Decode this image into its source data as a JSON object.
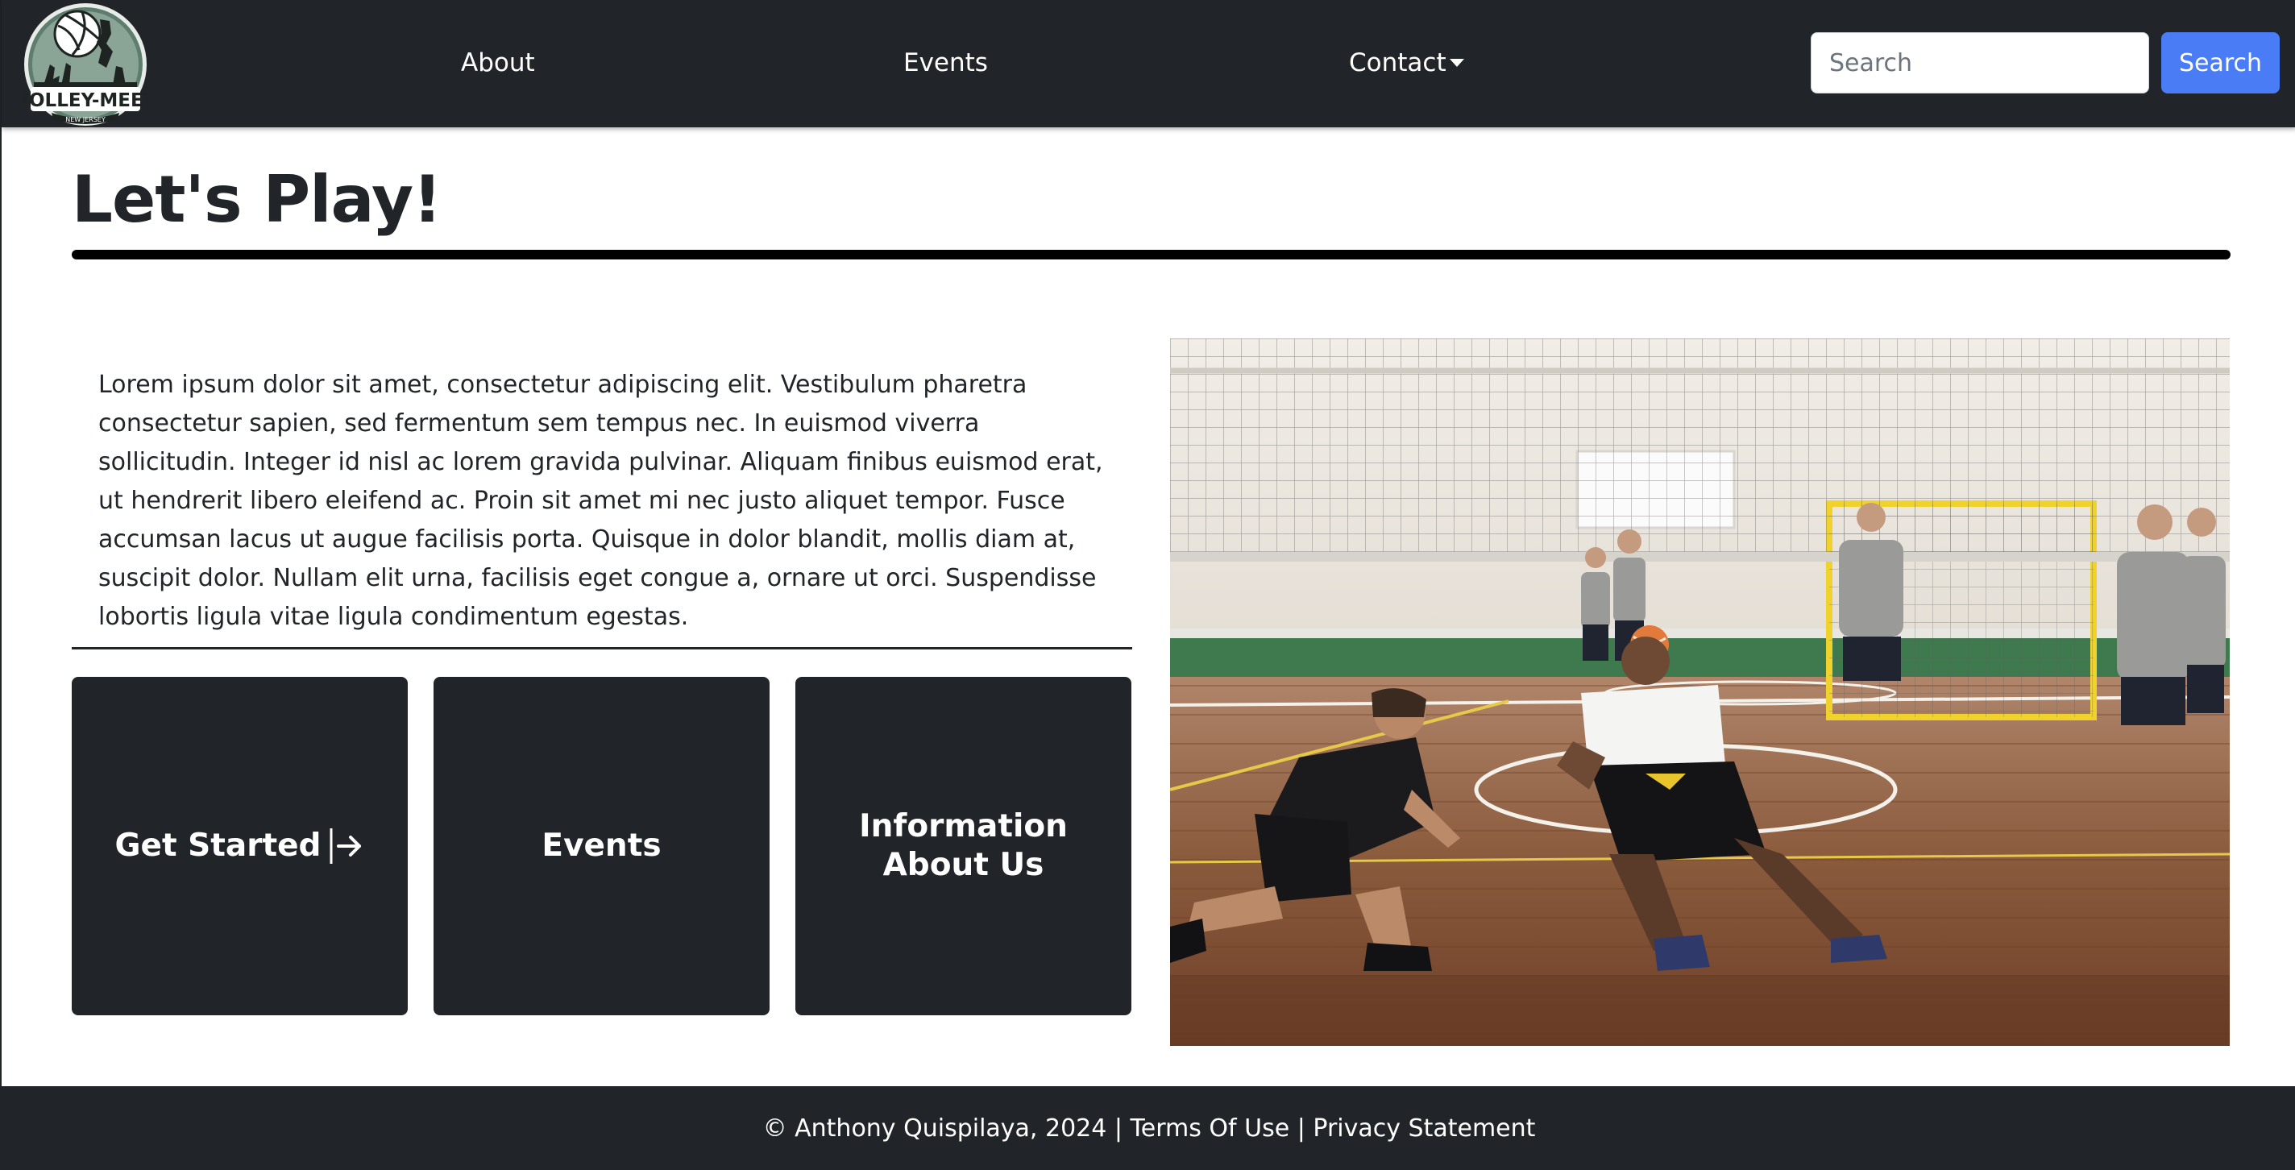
{
  "navbar": {
    "logo": {
      "name": "volley-meet-logo",
      "text_top": "VOLLEY-MEET",
      "text_bottom": "NEW JERSEY"
    },
    "links": [
      {
        "label": "About"
      },
      {
        "label": "Events"
      },
      {
        "label": "Contact"
      }
    ],
    "search": {
      "placeholder": "Search",
      "value": "",
      "button_label": "Search"
    }
  },
  "page": {
    "title": "Let's Play!",
    "intro": "Lorem ipsum dolor sit amet, consectetur adipiscing elit. Vestibulum pharetra consectetur sapien, sed fermentum sem tempus nec. In euismod viverra sollicitudin. Integer id nisl ac lorem gravida pulvinar. Aliquam finibus euismod erat, ut hendrerit libero eleifend ac. Proin sit amet mi nec justo aliquet tempor. Fusce accumsan lacus ut augue facilisis porta. Quisque in dolor blandit, mollis diam at, suscipit dolor. Nullam elit urna, facilisis eget congue a, ornare ut orci. Suspendisse lobortis ligula vitae ligula condimentum egestas."
  },
  "cards": [
    {
      "label": "Get Started",
      "icon": "arrow-right-icon"
    },
    {
      "label": "Events"
    },
    {
      "label": "Information About Us"
    }
  ],
  "hero_image": {
    "subject": "indoor volleyball game photo"
  },
  "footer": {
    "copyright": "© Anthony Quispilaya, 2024",
    "separator": " | ",
    "terms": "Terms Of Use",
    "privacy": "Privacy Statement"
  },
  "colors": {
    "navbar_bg": "#212529",
    "accent_blue": "#4a7cf6",
    "card_bg": "#212529",
    "text": "#212529"
  }
}
